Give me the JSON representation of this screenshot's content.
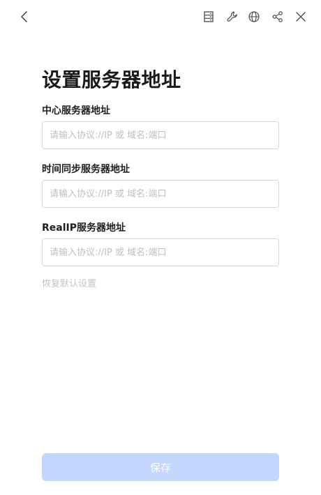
{
  "header": {
    "icons": [
      "back-icon",
      "server-list-icon",
      "wrench-icon",
      "globe-icon",
      "share-icon",
      "close-icon"
    ]
  },
  "page": {
    "title": "设置服务器地址"
  },
  "form": {
    "center_server": {
      "label": "中心服务器地址",
      "value": "",
      "placeholder": "请输入协议://IP 或 域名:端口"
    },
    "time_sync_server": {
      "label": "时间同步服务器地址",
      "value": "",
      "placeholder": "请输入协议://IP 或 域名:端口"
    },
    "realip_server": {
      "label": "RealIP服务器地址",
      "value": "",
      "placeholder": "请输入协议://IP 或 域名:端口"
    },
    "reset_label": "恢复默认设置",
    "save_label": "保存"
  },
  "colors": {
    "save_button_bg": "#c3d6fd",
    "icon": "#555555",
    "placeholder": "#bfbfbf",
    "reset_text": "#c4c4c4"
  }
}
